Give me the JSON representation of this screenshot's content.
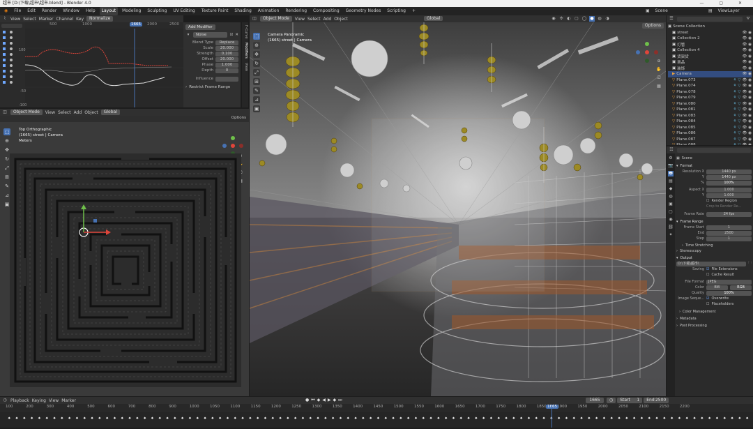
{
  "window_title": "超市 [D:\\下载\\超市\\超市.blend] - Blender 4.0",
  "menu": [
    "File",
    "Edit",
    "Render",
    "Window",
    "Help"
  ],
  "workspaces": [
    "Layout",
    "Modeling",
    "Sculpting",
    "UV Editing",
    "Texture Paint",
    "Shading",
    "Animation",
    "Rendering",
    "Compositing",
    "Geometry Nodes",
    "Scripting",
    "+"
  ],
  "active_workspace": "Layout",
  "scene_label": "Scene",
  "viewlayer_label": "ViewLayer",
  "graph_editor": {
    "menus": [
      "View",
      "Select",
      "Marker",
      "Channel",
      "Key"
    ],
    "normalize": "Normalize",
    "frame_ticks": [
      "500",
      "1000",
      "1500",
      "2000",
      "2500"
    ],
    "current_frame": "1665",
    "y_ticks": [
      "100",
      "50",
      "0",
      "-50",
      "-100"
    ]
  },
  "modifier": {
    "title": "Add Modifier",
    "name": "Noise",
    "blend_type_label": "Blend Type",
    "blend_type": "Replace",
    "scale_label": "Scale",
    "scale": "20.000",
    "strength_label": "Strength",
    "strength": "0.100",
    "offset_label": "Offset",
    "offset": "20.000",
    "phase_label": "Phase",
    "phase": "1.000",
    "depth_label": "Depth",
    "depth": "0",
    "influence_label": "Influence",
    "restrict": "Restrict Frame Range",
    "side_tabs": [
      "F-Curve",
      "Modifiers",
      "View"
    ]
  },
  "left_view": {
    "mode": "Object Mode",
    "menus": [
      "View",
      "Select",
      "Add",
      "Object"
    ],
    "transform": "Global",
    "title": "Top Orthographic",
    "subtitle": "(1665) street | Camera",
    "units": "Meters",
    "options": "Options"
  },
  "main_view": {
    "mode": "Object Mode",
    "menus": [
      "View",
      "Select",
      "Add",
      "Object"
    ],
    "transform": "Global",
    "title": "Camera Panoramic",
    "subtitle": "(1665) street | Camera",
    "options": "Options"
  },
  "outliner": {
    "root": "Scene Collection",
    "items": [
      {
        "name": "street",
        "sel": false,
        "type": "coll"
      },
      {
        "name": "Collection 2",
        "sel": false,
        "type": "coll"
      },
      {
        "name": "灯管",
        "sel": false,
        "type": "coll"
      },
      {
        "name": "Collection 4",
        "sel": false,
        "type": "coll"
      },
      {
        "name": "货架货",
        "sel": false,
        "type": "coll"
      },
      {
        "name": "商品",
        "sel": false,
        "type": "coll"
      },
      {
        "name": "装饰",
        "sel": false,
        "type": "coll"
      },
      {
        "name": "Camera",
        "sel": true,
        "type": "cam"
      },
      {
        "name": "Plane.073",
        "sel": false,
        "type": "mesh"
      },
      {
        "name": "Plane.074",
        "sel": false,
        "type": "mesh"
      },
      {
        "name": "Plane.078",
        "sel": false,
        "type": "mesh"
      },
      {
        "name": "Plane.079",
        "sel": false,
        "type": "mesh"
      },
      {
        "name": "Plane.080",
        "sel": false,
        "type": "mesh"
      },
      {
        "name": "Plane.081",
        "sel": false,
        "type": "mesh"
      },
      {
        "name": "Plane.083",
        "sel": false,
        "type": "mesh"
      },
      {
        "name": "Plane.084",
        "sel": false,
        "type": "mesh"
      },
      {
        "name": "Plane.085",
        "sel": false,
        "type": "mesh"
      },
      {
        "name": "Plane.086",
        "sel": false,
        "type": "mesh"
      },
      {
        "name": "Plane.087",
        "sel": false,
        "type": "mesh"
      },
      {
        "name": "Plane.088",
        "sel": false,
        "type": "mesh"
      }
    ]
  },
  "properties": {
    "scene": "Scene",
    "format_title": "Format",
    "res_label": "Resolution X",
    "res_x": "1440 px",
    "y_label": "Y",
    "res_y": "1440 px",
    "pct": "100%",
    "aspect_label": "Aspect X",
    "aspect_x": "1.000",
    "aspect_y": "1.000",
    "render_region": "Render Region",
    "crop": "Crop to Render Re...",
    "fps_label": "Frame Rate",
    "fps": "24 fps",
    "frame_range_title": "Frame Range",
    "start_label": "Frame Start",
    "start": "1",
    "end_label": "End",
    "end": "2500",
    "step_label": "Step",
    "step": "1",
    "time_stretching": "Time Stretching",
    "stereoscopy": "Stereoscopy",
    "output_title": "Output",
    "path": "D:\\下载\\超市\\",
    "saving_label": "Saving",
    "file_ext": "File Extensions",
    "cache": "Cache Result",
    "file_format_label": "File Format",
    "file_format": "JPEG",
    "color_label": "Color",
    "bw": "BW",
    "rgb": "RGB",
    "quality_label": "Quality",
    "quality": "100%",
    "image_seq_label": "Image Seque...",
    "overwrite": "Overwrite",
    "placeholders": "Placeholders",
    "color_mgmt": "Color Management",
    "metadata": "Metadata",
    "post": "Post Processing"
  },
  "timeline": {
    "menus": [
      "Playback",
      "Keying",
      "View",
      "Marker"
    ],
    "current": "1665",
    "start_label": "Start",
    "start": "1",
    "end_label": "End",
    "end": "2500",
    "ticks": [
      "100",
      "200",
      "300",
      "400",
      "500",
      "600",
      "700",
      "800",
      "900",
      "1000",
      "1050",
      "1100",
      "1150",
      "1200",
      "1250",
      "1300",
      "1350",
      "1400",
      "1450",
      "1500",
      "1550",
      "1600",
      "1650",
      "1700",
      "1750",
      "1800",
      "1850",
      "1900",
      "1950",
      "2000",
      "2050",
      "2100",
      "2150",
      "2200"
    ],
    "current_badge": "1665"
  },
  "colors": {
    "accent": "#4772b3",
    "selected": "#334d80",
    "bg": "#1d1d1d",
    "panel": "#303030"
  }
}
